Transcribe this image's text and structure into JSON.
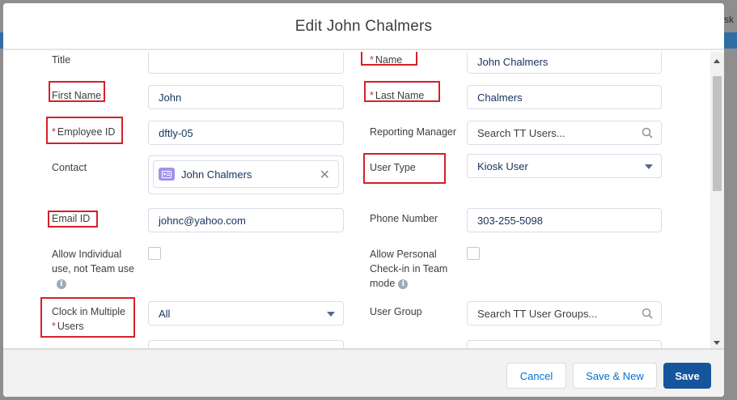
{
  "background": {
    "text_fragment": "sk"
  },
  "modal": {
    "title": "Edit John Chalmers"
  },
  "form": {
    "title": {
      "label": "Title",
      "value": ""
    },
    "name": {
      "label": "Name",
      "required_mark": "*",
      "value": "John Chalmers"
    },
    "first_name": {
      "label": "First Name",
      "value": "John"
    },
    "last_name": {
      "label": "Last Name",
      "required_mark": "*",
      "value": "Chalmers"
    },
    "employee_id": {
      "label": "Employee ID",
      "required_mark": "*",
      "value": "dftly-05"
    },
    "reporting_manager": {
      "label": "Reporting Manager",
      "placeholder": "Search TT Users..."
    },
    "contact": {
      "label": "Contact",
      "value": "John Chalmers"
    },
    "user_type": {
      "label": "User Type",
      "value": "Kiosk User"
    },
    "email_id": {
      "label": "Email ID",
      "value": "johnc@yahoo.com"
    },
    "phone_number": {
      "label": "Phone Number",
      "value": "303-255-5098"
    },
    "allow_individual": {
      "label_line1": "Allow Individual",
      "label_line2": "use, not Team use"
    },
    "allow_personal": {
      "label_line1": "Allow Personal",
      "label_line2": "Check-in in Team",
      "label_line3": "mode"
    },
    "clock_in_multiple": {
      "label_line1": "Clock in Multiple",
      "label_line2": "Users",
      "required_mark": "*",
      "value": "All"
    },
    "user_group": {
      "label": "User Group",
      "placeholder": "Search TT User Groups..."
    }
  },
  "footer": {
    "cancel_label": "Cancel",
    "save_new_label": "Save & New",
    "save_label": "Save"
  },
  "colors": {
    "brand_button": "#16549d",
    "annotation_box": "#d6202a",
    "required": "#c23934"
  }
}
